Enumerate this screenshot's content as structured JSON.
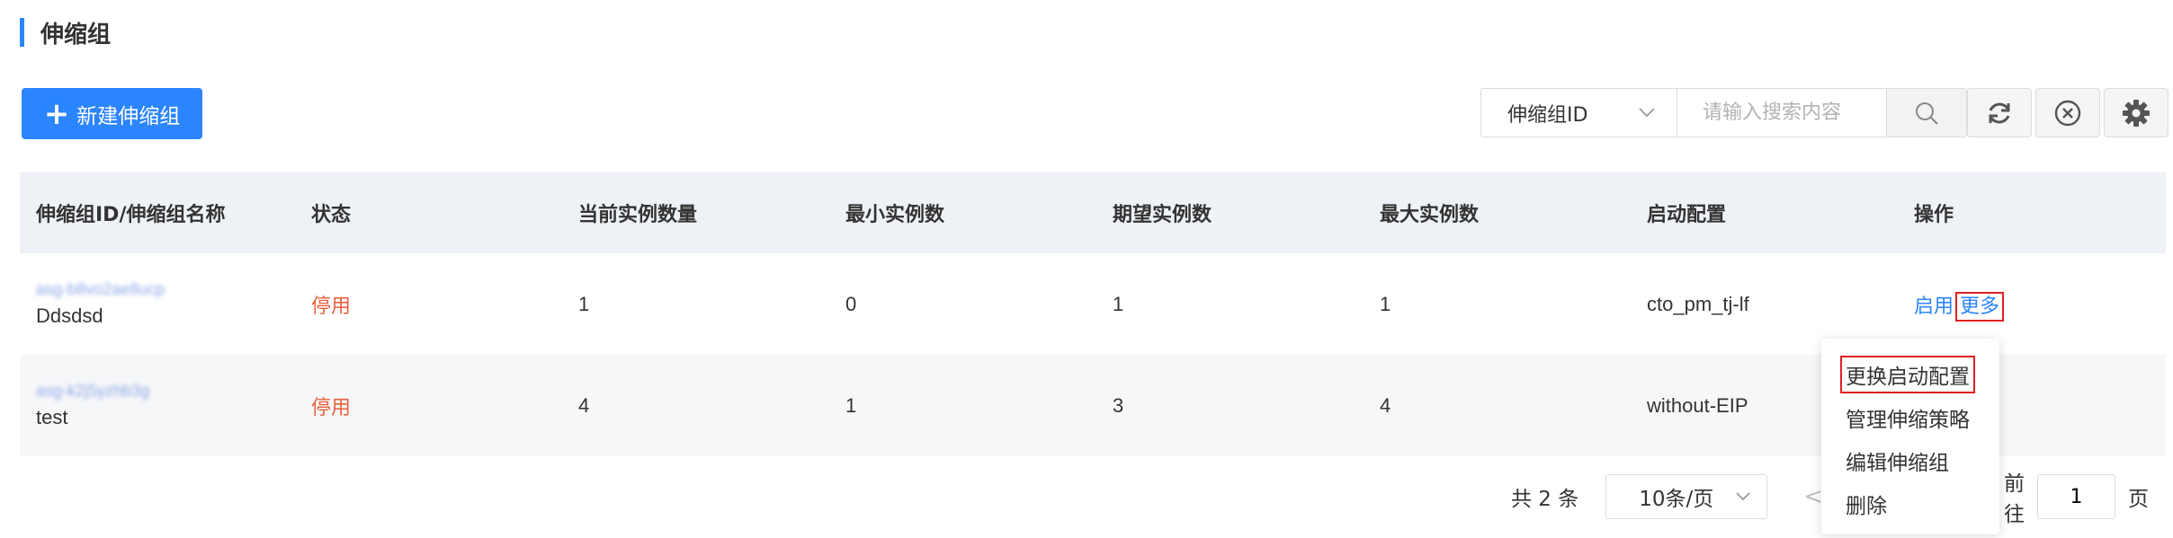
{
  "page": {
    "title": "伸缩组"
  },
  "toolbar": {
    "create_label": "新建伸缩组",
    "search_field": "伸缩组ID",
    "search_placeholder": "请输入搜索内容"
  },
  "table": {
    "columns": [
      "伸缩组ID/伸缩组名称",
      "状态",
      "当前实例数量",
      "最小实例数",
      "期望实例数",
      "最大实例数",
      "启动配置",
      "操作"
    ],
    "rows": [
      {
        "id": "asg-b8vo2ae8ucp",
        "name": "Ddsdsd",
        "status": "停用",
        "current": "1",
        "min": "0",
        "desired": "1",
        "max": "1",
        "launch_config": "cto_pm_tj-lf",
        "op_enable": "启用",
        "op_more": "更多"
      },
      {
        "id": "asg-k2j5yzhb3g",
        "name": "test",
        "status": "停用",
        "current": "4",
        "min": "1",
        "desired": "3",
        "max": "4",
        "launch_config": "without-EIP"
      }
    ]
  },
  "pagination": {
    "total": "共 2 条",
    "page_size": "10条/页",
    "prev": "<",
    "goto_label": "前往",
    "current_page": "1",
    "page_unit": "页"
  },
  "dropdown": {
    "items": [
      "更换启动配置",
      "管理伸缩策略",
      "编辑伸缩组",
      "删除"
    ]
  },
  "colors": {
    "primary": "#2b85ff",
    "status_off": "#e8603c",
    "highlight_border": "#e02020"
  }
}
